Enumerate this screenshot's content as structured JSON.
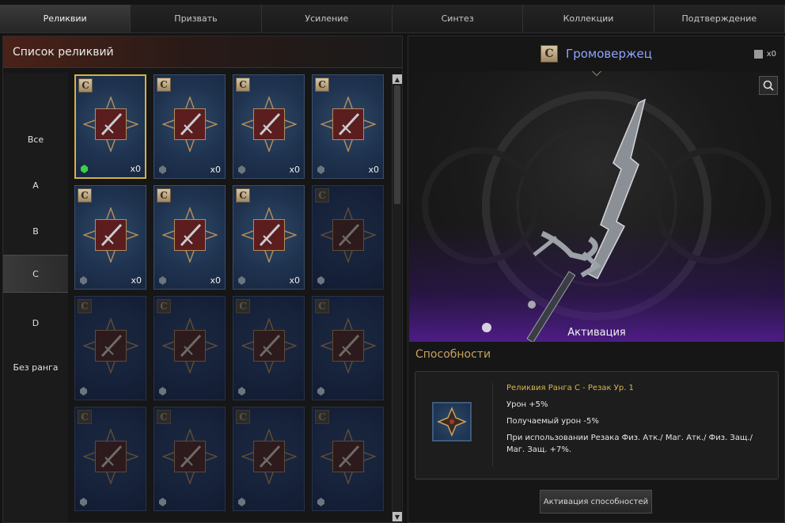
{
  "tabs": [
    {
      "label": "Реликвии",
      "active": true
    },
    {
      "label": "Призвать",
      "active": false
    },
    {
      "label": "Усиление",
      "active": false
    },
    {
      "label": "Синтез",
      "active": false
    },
    {
      "label": "Коллекции",
      "active": false
    },
    {
      "label": "Подтверждение",
      "active": false
    }
  ],
  "relic_list": {
    "title": "Список реликвий",
    "ranks": [
      {
        "label": "Все",
        "active": false
      },
      {
        "label": "A",
        "active": false
      },
      {
        "label": "B",
        "active": false
      },
      {
        "label": "C",
        "active": true
      },
      {
        "label": "D",
        "active": false
      },
      {
        "label": "Без ранга",
        "active": false
      }
    ],
    "cards": [
      {
        "rank": "C",
        "count": "x0",
        "owned": true,
        "selected": true,
        "gem": "green",
        "icon": "winged-sword-icon"
      },
      {
        "rank": "C",
        "count": "x0",
        "owned": true,
        "selected": false,
        "gem": "grey",
        "icon": "scimitar-icon"
      },
      {
        "rank": "C",
        "count": "x0",
        "owned": true,
        "selected": false,
        "gem": "grey",
        "icon": "trident-icon"
      },
      {
        "rank": "C",
        "count": "x0",
        "owned": true,
        "selected": false,
        "gem": "grey",
        "icon": "bow-icon"
      },
      {
        "rank": "C",
        "count": "x0",
        "owned": true,
        "selected": false,
        "gem": "grey",
        "icon": "red-sword-icon"
      },
      {
        "rank": "C",
        "count": "x0",
        "owned": true,
        "selected": false,
        "gem": "grey",
        "icon": "crossed-blades-icon"
      },
      {
        "rank": "C",
        "count": "x0",
        "owned": true,
        "selected": false,
        "gem": "grey",
        "icon": "crystal-blade-icon"
      },
      {
        "rank": "C",
        "count": "",
        "owned": false,
        "selected": false,
        "gem": "grey",
        "icon": "dagger-icon"
      },
      {
        "rank": "C",
        "count": "",
        "owned": false,
        "selected": false,
        "gem": "grey",
        "icon": "sword-icon"
      },
      {
        "rank": "C",
        "count": "",
        "owned": false,
        "selected": false,
        "gem": "grey",
        "icon": "axe-icon"
      },
      {
        "rank": "C",
        "count": "",
        "owned": false,
        "selected": false,
        "gem": "grey",
        "icon": "spear-icon"
      },
      {
        "rank": "C",
        "count": "",
        "owned": false,
        "selected": false,
        "gem": "grey",
        "icon": "mace-icon"
      },
      {
        "rank": "C",
        "count": "",
        "owned": false,
        "selected": false,
        "gem": "grey",
        "icon": "golden-sword-icon"
      },
      {
        "rank": "C",
        "count": "",
        "owned": false,
        "selected": false,
        "gem": "grey",
        "icon": "greatsword-icon"
      },
      {
        "rank": "C",
        "count": "",
        "owned": false,
        "selected": false,
        "gem": "grey",
        "icon": "twin-swords-icon"
      },
      {
        "rank": "C",
        "count": "",
        "owned": false,
        "selected": false,
        "gem": "grey",
        "icon": "twin-blades-icon"
      }
    ]
  },
  "detail": {
    "rank": "C",
    "name": "Громовержец",
    "book_count": "x0",
    "activation_label": "Активация",
    "abilities_title": "Способности",
    "ability": {
      "title": "Реликвия Ранга C - Резак Ур. 1",
      "lines": [
        "Урон +5%",
        "Получаемый урон -5%",
        "При использовании Резака Физ. Атк./ Маг. Атк./ Физ. Защ./ Маг. Защ. +7%."
      ]
    },
    "activate_button": "Активация способностей"
  },
  "colors": {
    "selected_border": "#d7b33a",
    "relic_name": "#8fa3ff",
    "abilities_title": "#c8a15e",
    "ability_title": "#d9b54a"
  }
}
